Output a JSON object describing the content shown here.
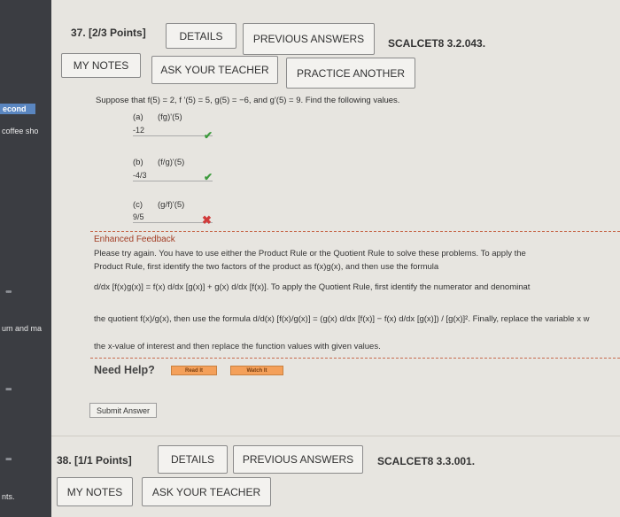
{
  "sidebar": {
    "items": [
      "econd",
      "coffee sho",
      "um and ma",
      "nts."
    ]
  },
  "q37": {
    "number": "37. [2/3 Points]",
    "code": "SCALCET8 3.2.043.",
    "buttons": {
      "details": "DETAILS",
      "previous_answers": "PREVIOUS ANSWERS",
      "my_notes": "MY NOTES",
      "ask_teacher": "ASK YOUR TEACHER",
      "practice_another": "PRACTICE ANOTHER"
    },
    "prompt": "Suppose that f(5) = 2, f '(5) = 5, g(5) = −6, and g'(5) = 9. Find the following values.",
    "parts": [
      {
        "label": "(a)",
        "expr": "(fg)'(5)",
        "answer": "-12",
        "status": "correct"
      },
      {
        "label": "(b)",
        "expr": "(f/g)'(5)",
        "answer": "-4/3",
        "status": "correct"
      },
      {
        "label": "(c)",
        "expr": "(g/f)'(5)",
        "answer": "9/5",
        "status": "incorrect"
      }
    ],
    "feedback": {
      "title": "Enhanced Feedback",
      "lines": [
        "Please try again. You have to use either the Product Rule or the Quotient Rule to solve these problems. To apply the",
        "Product Rule, first identify the two factors of the product as f(x)g(x), and then use the formula",
        "d/dx [f(x)g(x)] = f(x) d/dx [g(x)] + g(x) d/dx [f(x)]. To apply the Quotient Rule, first identify the numerator and denominat",
        "the quotient f(x)/g(x), then use the formula d/d(x) [f(x)/g(x)] = (g(x) d/dx [f(x)] − f(x) d/dx [g(x)]) / [g(x)]². Finally, replace the variable x w",
        "the x-value of interest and then replace the function values with given values."
      ]
    },
    "need_help": "Need Help?",
    "read_it": "Read It",
    "watch_it": "Watch It",
    "submit": "Submit Answer"
  },
  "q38": {
    "number": "38. [1/1 Points]",
    "code": "SCALCET8 3.3.001.",
    "buttons": {
      "details": "DETAILS",
      "previous_answers": "PREVIOUS ANSWERS",
      "my_notes": "MY NOTES",
      "ask_teacher": "ASK YOUR TEACHER"
    }
  },
  "colors": {
    "correct": "#3c9a3c",
    "incorrect": "#d13b3b",
    "feedback_border": "#c76a4d",
    "help_button": "#f4a05a"
  }
}
